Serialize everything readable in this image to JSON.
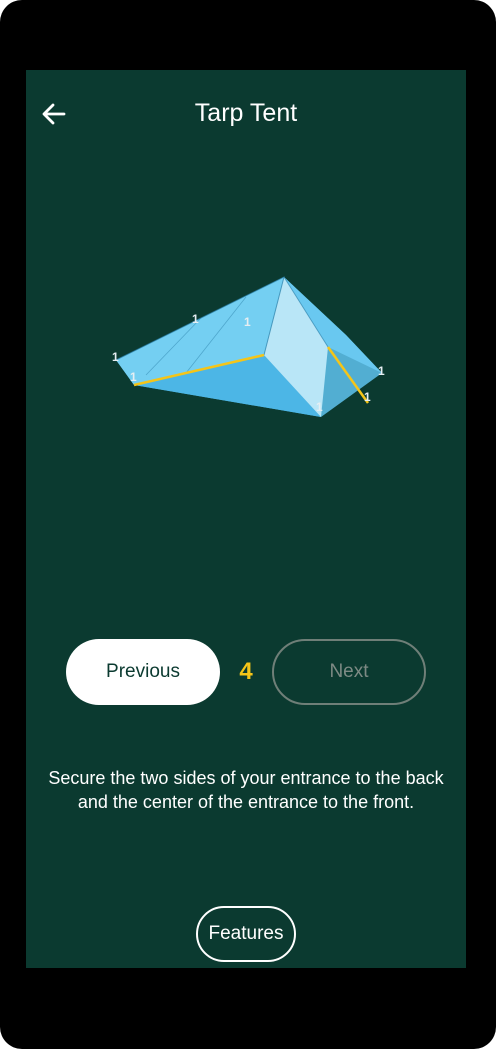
{
  "header": {
    "title": "Tarp Tent"
  },
  "illustration": {
    "anchor_labels": [
      "1",
      "1",
      "1",
      "1",
      "1",
      "1",
      "1"
    ]
  },
  "navigation": {
    "previous_label": "Previous",
    "step_number": "4",
    "next_label": "Next"
  },
  "instructions": {
    "text": "Secure the two sides of your entrance to the back and the center of the entrance to the front."
  },
  "footer": {
    "features_label": "Features"
  },
  "colors": {
    "background": "#0b3a30",
    "accent": "#f5c518",
    "tarp": "#5fc3ee"
  },
  "icons": {
    "back": "arrow-left-icon"
  }
}
